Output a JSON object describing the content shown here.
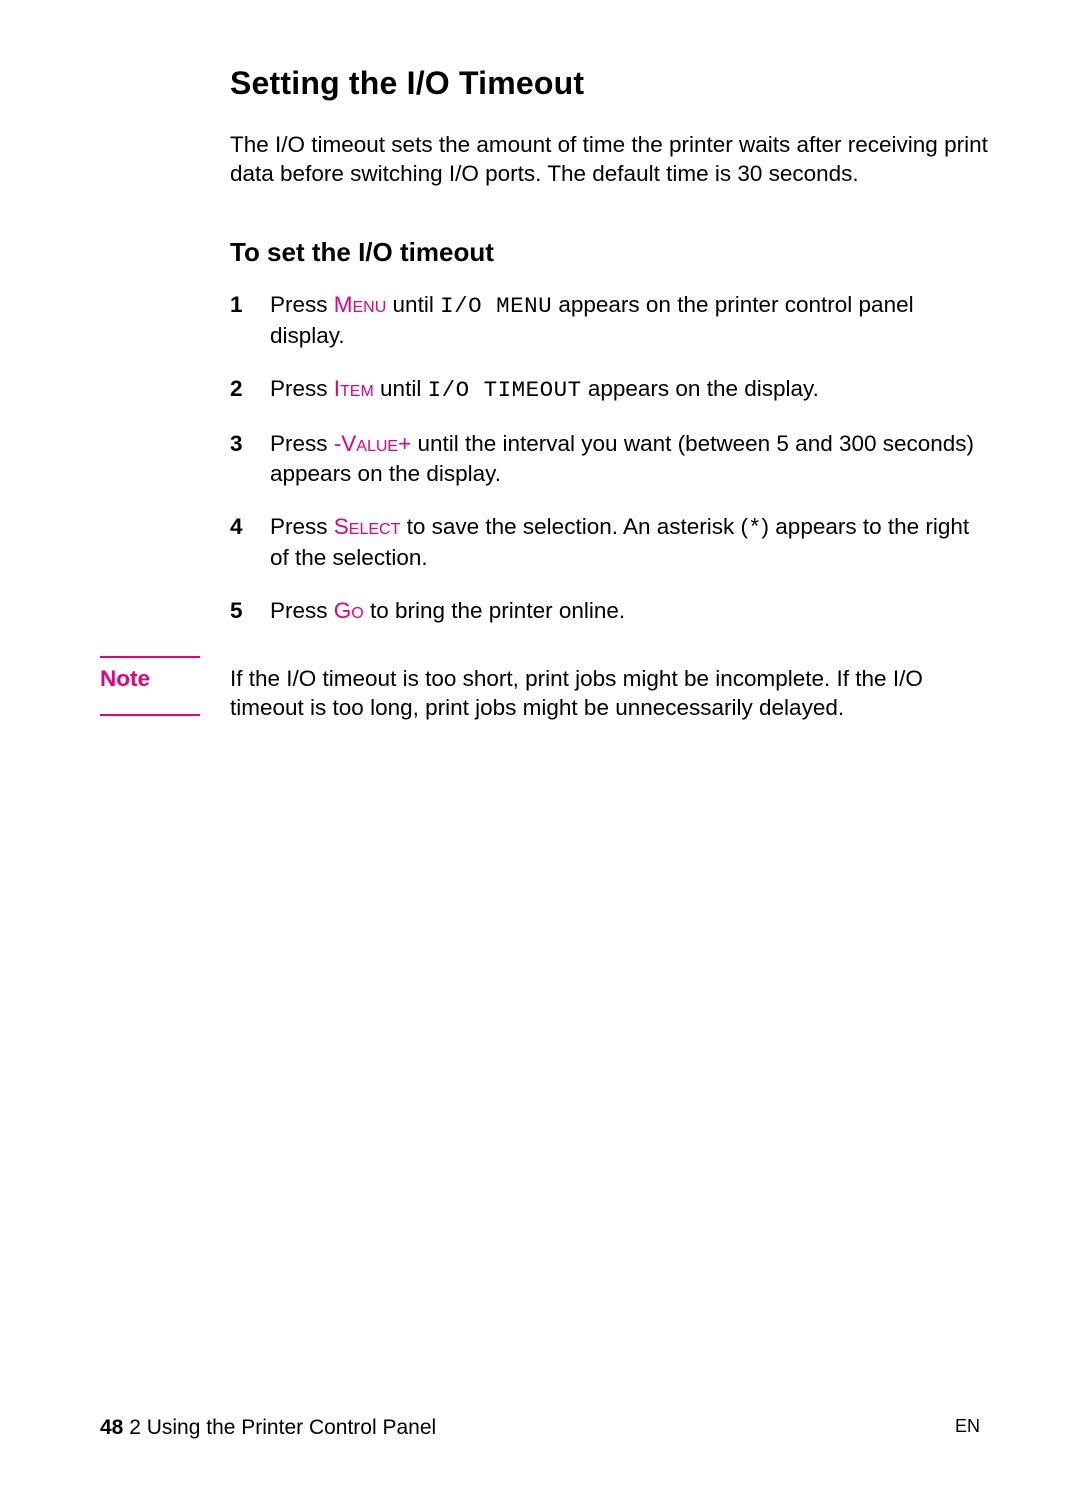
{
  "heading": "Setting the I/O Timeout",
  "intro": "The I/O timeout sets the amount of time the printer waits after receiving print data before switching I/O ports. The default time is 30 seconds.",
  "subheading": "To set the I/O timeout",
  "steps": [
    {
      "pre": "Press ",
      "accent": "Menu",
      "mid": " until ",
      "mono": "I/O MENU",
      "post": " appears on the printer control panel display."
    },
    {
      "pre": "Press ",
      "accent": "Item",
      "mid": " until ",
      "mono": "I/O TIMEOUT",
      "post": " appears on the display."
    },
    {
      "pre": "Press ",
      "accent": "-Value+",
      "mid": "",
      "mono": "",
      "post": " until the interval you want (between 5 and 300 seconds) appears on the display."
    },
    {
      "pre": "Press ",
      "accent": "Select",
      "mid": " to save the selection. An asterisk (",
      "mono": "*",
      "post": ") appears to the right of the selection."
    },
    {
      "pre": "Press ",
      "accent": "Go",
      "mid": "",
      "mono": "",
      "post": " to bring the printer online."
    }
  ],
  "note": {
    "label": "Note",
    "text": "If the I/O timeout is too short, print jobs might be incomplete. If the I/O timeout is too long, print jobs might be unnecessarily delayed."
  },
  "footer": {
    "page_number": "48",
    "chapter": " 2 Using the Printer Control Panel",
    "lang": "EN"
  }
}
